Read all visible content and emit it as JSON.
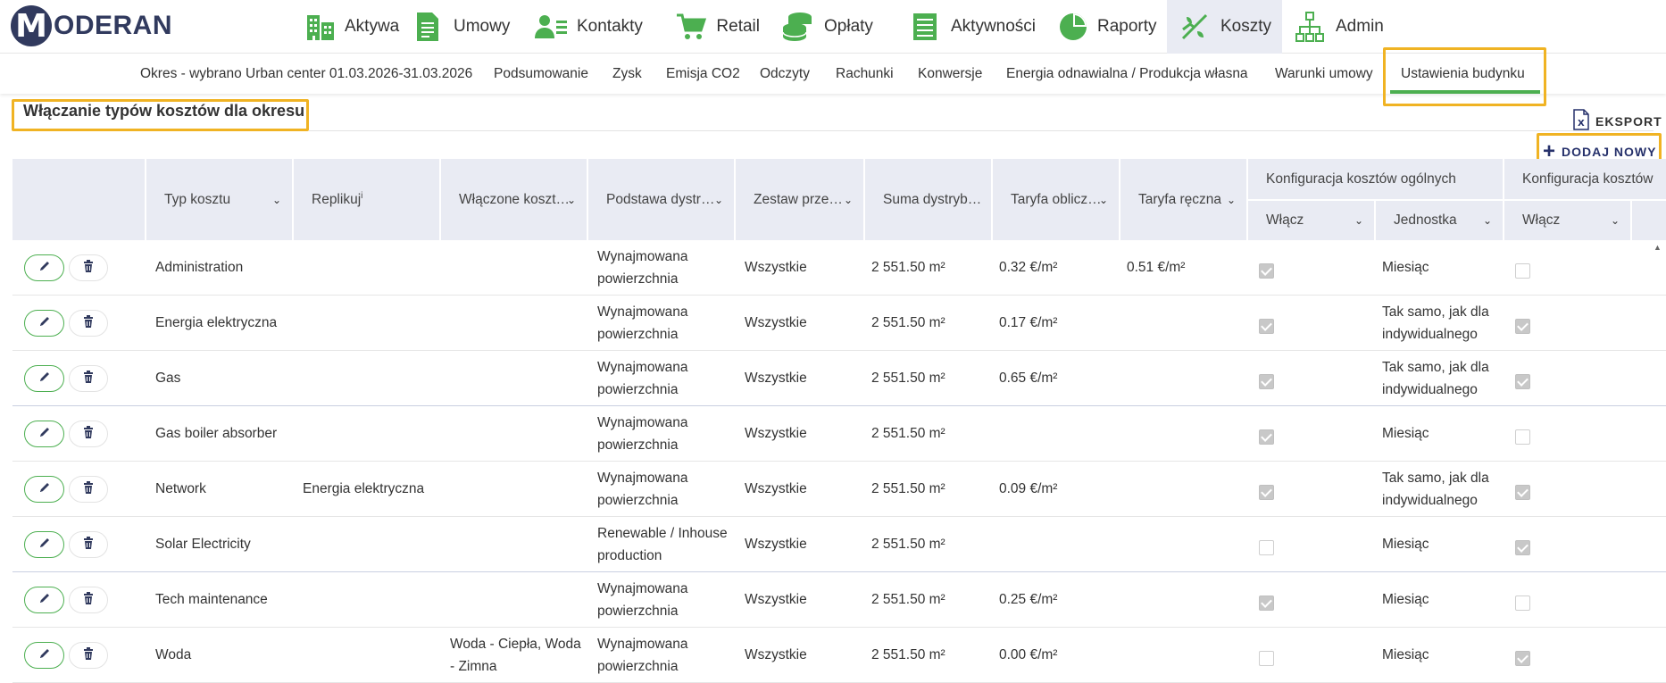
{
  "app": {
    "logo_letter": "M",
    "logo_text": "ODERAN"
  },
  "nav": [
    {
      "label": "Aktywa",
      "icon": "buildings-icon"
    },
    {
      "label": "Umowy",
      "icon": "document-icon"
    },
    {
      "label": "Kontakty",
      "icon": "contacts-icon"
    },
    {
      "label": "Retail",
      "icon": "cart-icon"
    },
    {
      "label": "Opłaty",
      "icon": "coins-icon"
    },
    {
      "label": "Aktywności",
      "icon": "list-icon"
    },
    {
      "label": "Raporty",
      "icon": "pie-chart-icon"
    },
    {
      "label": "Koszty",
      "icon": "costs-icon"
    },
    {
      "label": "Admin",
      "icon": "org-chart-icon"
    }
  ],
  "subnav": {
    "period": "Okres - wybrano Urban center 01.03.2026-31.03.2026",
    "items": [
      "Podsumowanie",
      "Zysk",
      "Emisja CO2",
      "Odczyty",
      "Rachunki",
      "Konwersje",
      "Energia odnawialna / Produkcja własna",
      "Warunki umowy",
      "Ustawienia budynku"
    ]
  },
  "page": {
    "title": "Włączanie typów kosztów dla okresu",
    "export_label": "EKSPORT",
    "add_label": "DODAJ NOWY"
  },
  "table": {
    "headers": {
      "type": "Typ kosztu",
      "replicate": "Replikuj",
      "replicate_sup": "i",
      "included": "Włączone koszt…",
      "basis": "Podstawa dystr…",
      "set": "Zestaw prze…",
      "sum": "Suma dystryb…",
      "tariff_calc": "Taryfa oblicz…",
      "tariff_manual": "Taryfa ręczna",
      "general_group": "Konfiguracja kosztów ogólnych",
      "general_on": "Włącz",
      "general_unit": "Jednostka",
      "second_group": "Konfiguracja kosztów",
      "second_on": "Włącz"
    },
    "rows": [
      {
        "type": "Administration",
        "replicate": "",
        "included": "",
        "basis": "Wynajmowana powierzchnia",
        "set": "Wszystkie",
        "sum": "2 551.50 m²",
        "tariff_calc": "0.32 €/m²",
        "tariff_manual": "0.51 €/m²",
        "gen_on": true,
        "unit": "Miesiąc",
        "sec_on": false
      },
      {
        "type": "Energia elektryczna",
        "replicate": "",
        "included": "",
        "basis": "Wynajmowana powierzchnia",
        "set": "Wszystkie",
        "sum": "2 551.50 m²",
        "tariff_calc": "0.17 €/m²",
        "tariff_manual": "",
        "gen_on": true,
        "unit": "Tak samo, jak dla indywidualnego",
        "sec_on": true
      },
      {
        "type": "Gas",
        "replicate": "",
        "included": "",
        "basis": "Wynajmowana powierzchnia",
        "set": "Wszystkie",
        "sum": "2 551.50 m²",
        "tariff_calc": "0.65 €/m²",
        "tariff_manual": "",
        "gen_on": true,
        "unit": "Tak samo, jak dla indywidualnego",
        "sec_on": true
      },
      {
        "type": "Gas boiler absorber",
        "replicate": "",
        "included": "",
        "basis": "Wynajmowana powierzchnia",
        "set": "Wszystkie",
        "sum": "2 551.50 m²",
        "tariff_calc": "",
        "tariff_manual": "",
        "gen_on": true,
        "unit": "Miesiąc",
        "sec_on": false
      },
      {
        "type": "Network",
        "replicate": "Energia elektryczna",
        "included": "",
        "basis": "Wynajmowana powierzchnia",
        "set": "Wszystkie",
        "sum": "2 551.50 m²",
        "tariff_calc": "0.09 €/m²",
        "tariff_manual": "",
        "gen_on": true,
        "unit": "Tak samo, jak dla indywidualnego",
        "sec_on": true
      },
      {
        "type": "Solar Electricity",
        "replicate": "",
        "included": "",
        "basis": "Renewable / Inhouse production",
        "set": "Wszystkie",
        "sum": "2 551.50 m²",
        "tariff_calc": "",
        "tariff_manual": "",
        "gen_on": false,
        "unit": "Miesiąc",
        "sec_on": true
      },
      {
        "type": "Tech maintenance",
        "replicate": "",
        "included": "",
        "basis": "Wynajmowana powierzchnia",
        "set": "Wszystkie",
        "sum": "2 551.50 m²",
        "tariff_calc": "0.25 €/m²",
        "tariff_manual": "",
        "gen_on": true,
        "unit": "Miesiąc",
        "sec_on": false
      },
      {
        "type": "Woda",
        "replicate": "",
        "included": "Woda - Ciepła, Woda - Zimna",
        "basis": "Wynajmowana powierzchnia",
        "set": "Wszystkie",
        "sum": "2 551.50 m²",
        "tariff_calc": "0.00 €/m²",
        "tariff_manual": "",
        "gen_on": false,
        "unit": "Miesiąc",
        "sec_on": true
      }
    ]
  },
  "colors": {
    "accent_green": "#4caf50",
    "brand_navy": "#313a5e",
    "highlight": "#f0b323",
    "header_bg": "#e9ebf3"
  }
}
